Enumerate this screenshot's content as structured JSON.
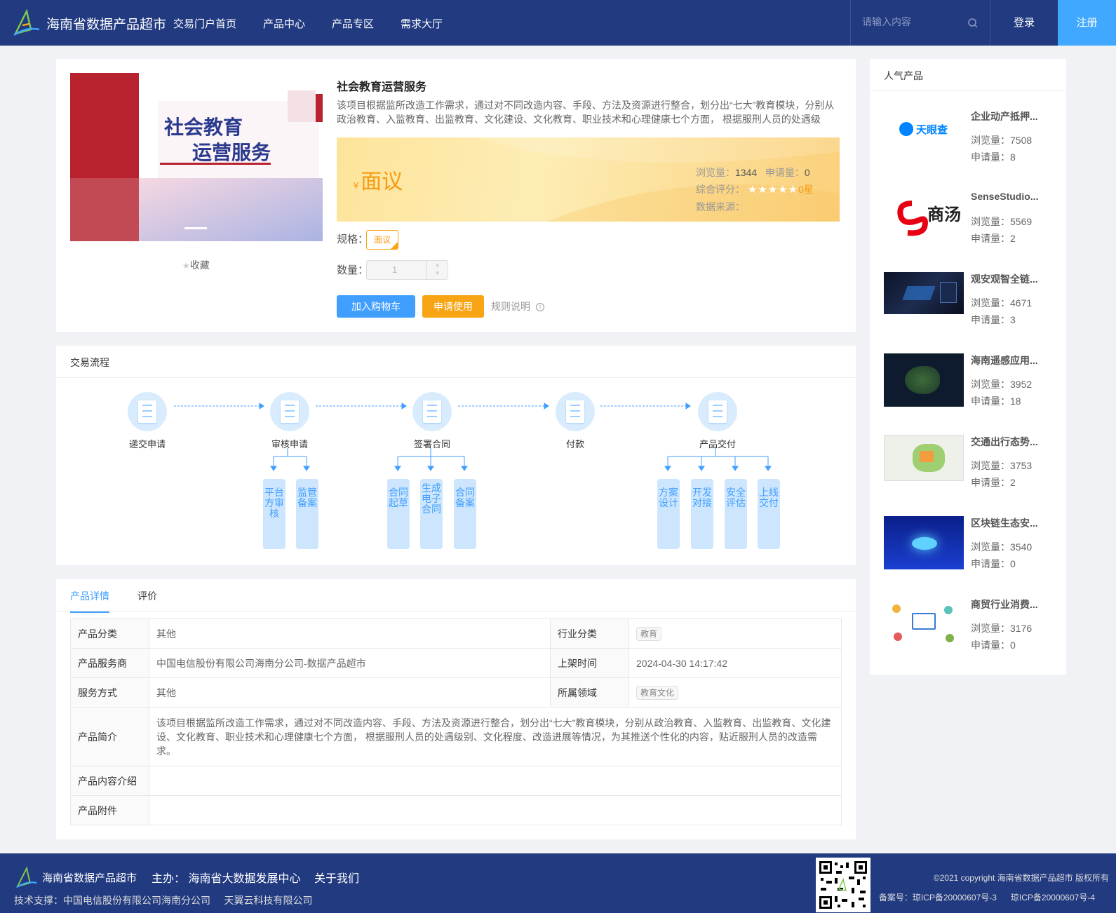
{
  "header": {
    "site_title": "海南省数据产品超市",
    "nav": [
      "交易门户首页",
      "产品中心",
      "产品专区",
      "需求大厅"
    ],
    "search_placeholder": "请输入内容",
    "login": "登录",
    "register": "注册"
  },
  "product": {
    "image_text_1": "社会教育",
    "image_text_2": "运营服务",
    "favorite": "收藏",
    "title": "社会教育运营服务",
    "description": "该项目根据监所改造工作需求，通过对不同改造内容、手段、方法及资源进行整合，划分出“七大”教育模块，分别从政治教育、入监教育、出监教育、文化建设、文化教育、职业技术和心理健康七个方面， 根据服刑人员的处遇级别、文化程度、改造进展等情况，为其推送个性化的内容，贴近服刑人员的改造需求。",
    "currency": "¥",
    "price": "面议",
    "views_label": "浏览量：",
    "views": "1344",
    "applies_label": "申请量：",
    "applies": "0",
    "rating_label": "综合评分：",
    "rating": "0星",
    "source_label": "数据来源：",
    "spec_label": "规格：",
    "spec_value": "面议",
    "qty_label": "数量：",
    "qty_value": "1",
    "add_cart": "加入购物车",
    "apply_use": "申请使用",
    "rules": "规则说明"
  },
  "flow": {
    "title": "交易流程",
    "steps": [
      "递交申请",
      "审核申请",
      "签署合同",
      "付款",
      "产品交付"
    ],
    "sub_audit": [
      "平台方审核",
      "监管备案"
    ],
    "sub_contract": [
      "合同起草",
      "生成电子合同",
      "合同备案"
    ],
    "sub_delivery": [
      "方案设计",
      "开发对接",
      "安全评估",
      "上线交付"
    ]
  },
  "details": {
    "tabs": [
      "产品详情",
      "评价"
    ],
    "rows": {
      "category_k": "产品分类",
      "category_v": "其他",
      "industry_k": "行业分类",
      "industry_v": "教育",
      "provider_k": "产品服务商",
      "provider_v": "中国电信股份有限公司海南分公司-数据产品超市",
      "listed_k": "上架时间",
      "listed_v": "2024-04-30 14:17:42",
      "service_k": "服务方式",
      "service_v": "其他",
      "domain_k": "所属领域",
      "domain_v": "教育文化",
      "intro_k": "产品简介",
      "intro_v": "该项目根据监所改造工作需求，通过对不同改造内容、手段、方法及资源进行整合，划分出“七大”教育模块，分别从政治教育、入监教育、出监教育、文化建设、文化教育、职业技术和心理健康七个方面， 根据服刑人员的处遇级别、文化程度、改造进展等情况，为其推送个性化的内容，贴近服刑人员的改造需求。",
      "content_k": "产品内容介绍",
      "attach_k": "产品附件"
    }
  },
  "popular": {
    "title": "人气产品",
    "views_label": "浏览量：",
    "applies_label": "申请量：",
    "items": [
      {
        "name": "企业动产抵押...",
        "views": "7508",
        "applies": "8",
        "logo": "天眼查"
      },
      {
        "name": "SenseStudio...",
        "views": "5569",
        "applies": "2",
        "logo": "商汤"
      },
      {
        "name": "观安观智全链...",
        "views": "4671",
        "applies": "3"
      },
      {
        "name": "海南遥感应用...",
        "views": "3952",
        "applies": "18"
      },
      {
        "name": "交通出行态势...",
        "views": "3753",
        "applies": "2"
      },
      {
        "name": "区块链生态安...",
        "views": "3540",
        "applies": "0"
      },
      {
        "name": "商贸行业消费...",
        "views": "3176",
        "applies": "0"
      }
    ]
  },
  "footer": {
    "site_title": "海南省数据产品超市",
    "host": "主办： 海南省大数据发展中心",
    "about": "关于我们",
    "tech": "技术支撑：中国电信股份有限公司海南分公司     天翼云科技有限公司",
    "copyright": "©2021 copyright 海南省数据产品超市 版权所有",
    "icp1": "备案号：琼ICP备20000607号-3",
    "icp2": "琼ICP备20000607号-4"
  }
}
